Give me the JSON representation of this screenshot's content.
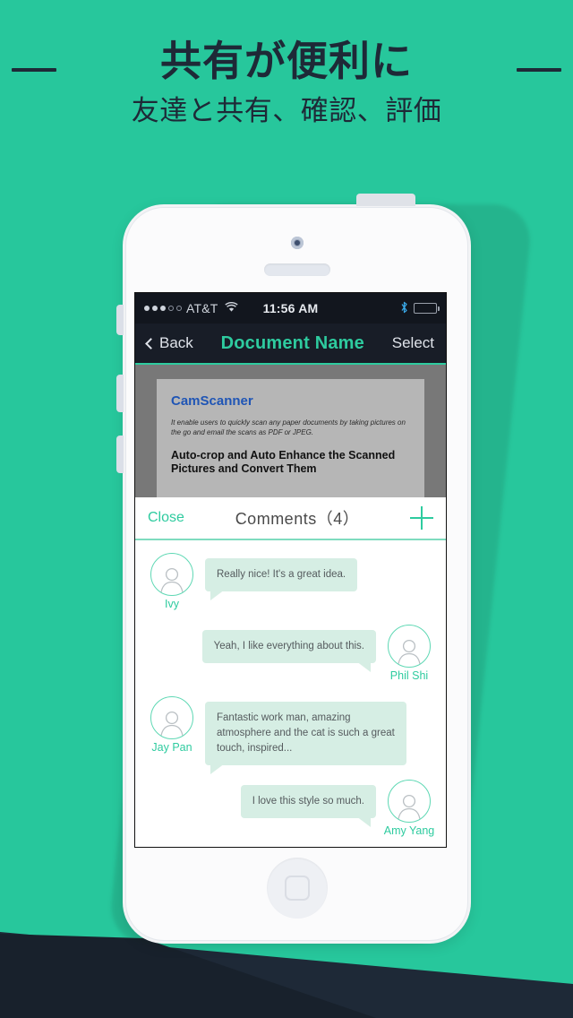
{
  "colors": {
    "brand_green": "#27c79c",
    "mint": "#2ecb9f",
    "navy": "#1e2937",
    "bubble": "#d6eee4",
    "doc_blue": "#1f55b5"
  },
  "promo": {
    "headline": "共有が便利に",
    "subhead": "友達と共有、確認、評価"
  },
  "status_bar": {
    "carrier": "AT&T",
    "time": "11:56 AM",
    "signal_dots_filled": 3,
    "signal_dots_total": 5,
    "wifi_icon": "wifi-icon",
    "bluetooth_icon": "bluetooth-icon",
    "battery_icon": "battery-icon"
  },
  "nav_bar": {
    "back_label": "Back",
    "back_icon": "chevron-left-icon",
    "title": "Document Name",
    "select_label": "Select"
  },
  "document_preview": {
    "brand": "CamScanner",
    "description": "It enable users to quickly scan any paper documents by taking pictures on the go and email the scans as PDF or JPEG.",
    "heading": "Auto-crop and Auto Enhance the Scanned Pictures and Convert Them"
  },
  "comments_panel": {
    "close_label": "Close",
    "title": "Comments（4）",
    "add_icon": "plus-icon",
    "count": 4,
    "items": [
      {
        "author": "Ivy",
        "text": "Really nice! It's a great idea.",
        "side": "left"
      },
      {
        "author": "Phil Shi",
        "text": "Yeah, I like everything about this.",
        "side": "right"
      },
      {
        "author": "Jay Pan",
        "text": "Fantastic work man, amazing atmosphere and the cat is such a great touch, inspired...",
        "side": "left"
      },
      {
        "author": "Amy Yang",
        "text": "I love this style so much.",
        "side": "right"
      }
    ]
  },
  "device": {
    "camera_icon": "camera-icon",
    "speaker_icon": "speaker-grille-icon",
    "home_button_icon": "home-button-icon",
    "power_button_icon": "power-button-icon",
    "silent_switch_icon": "silent-switch-icon",
    "volume_up_icon": "volume-up-button-icon",
    "volume_down_icon": "volume-down-button-icon"
  }
}
